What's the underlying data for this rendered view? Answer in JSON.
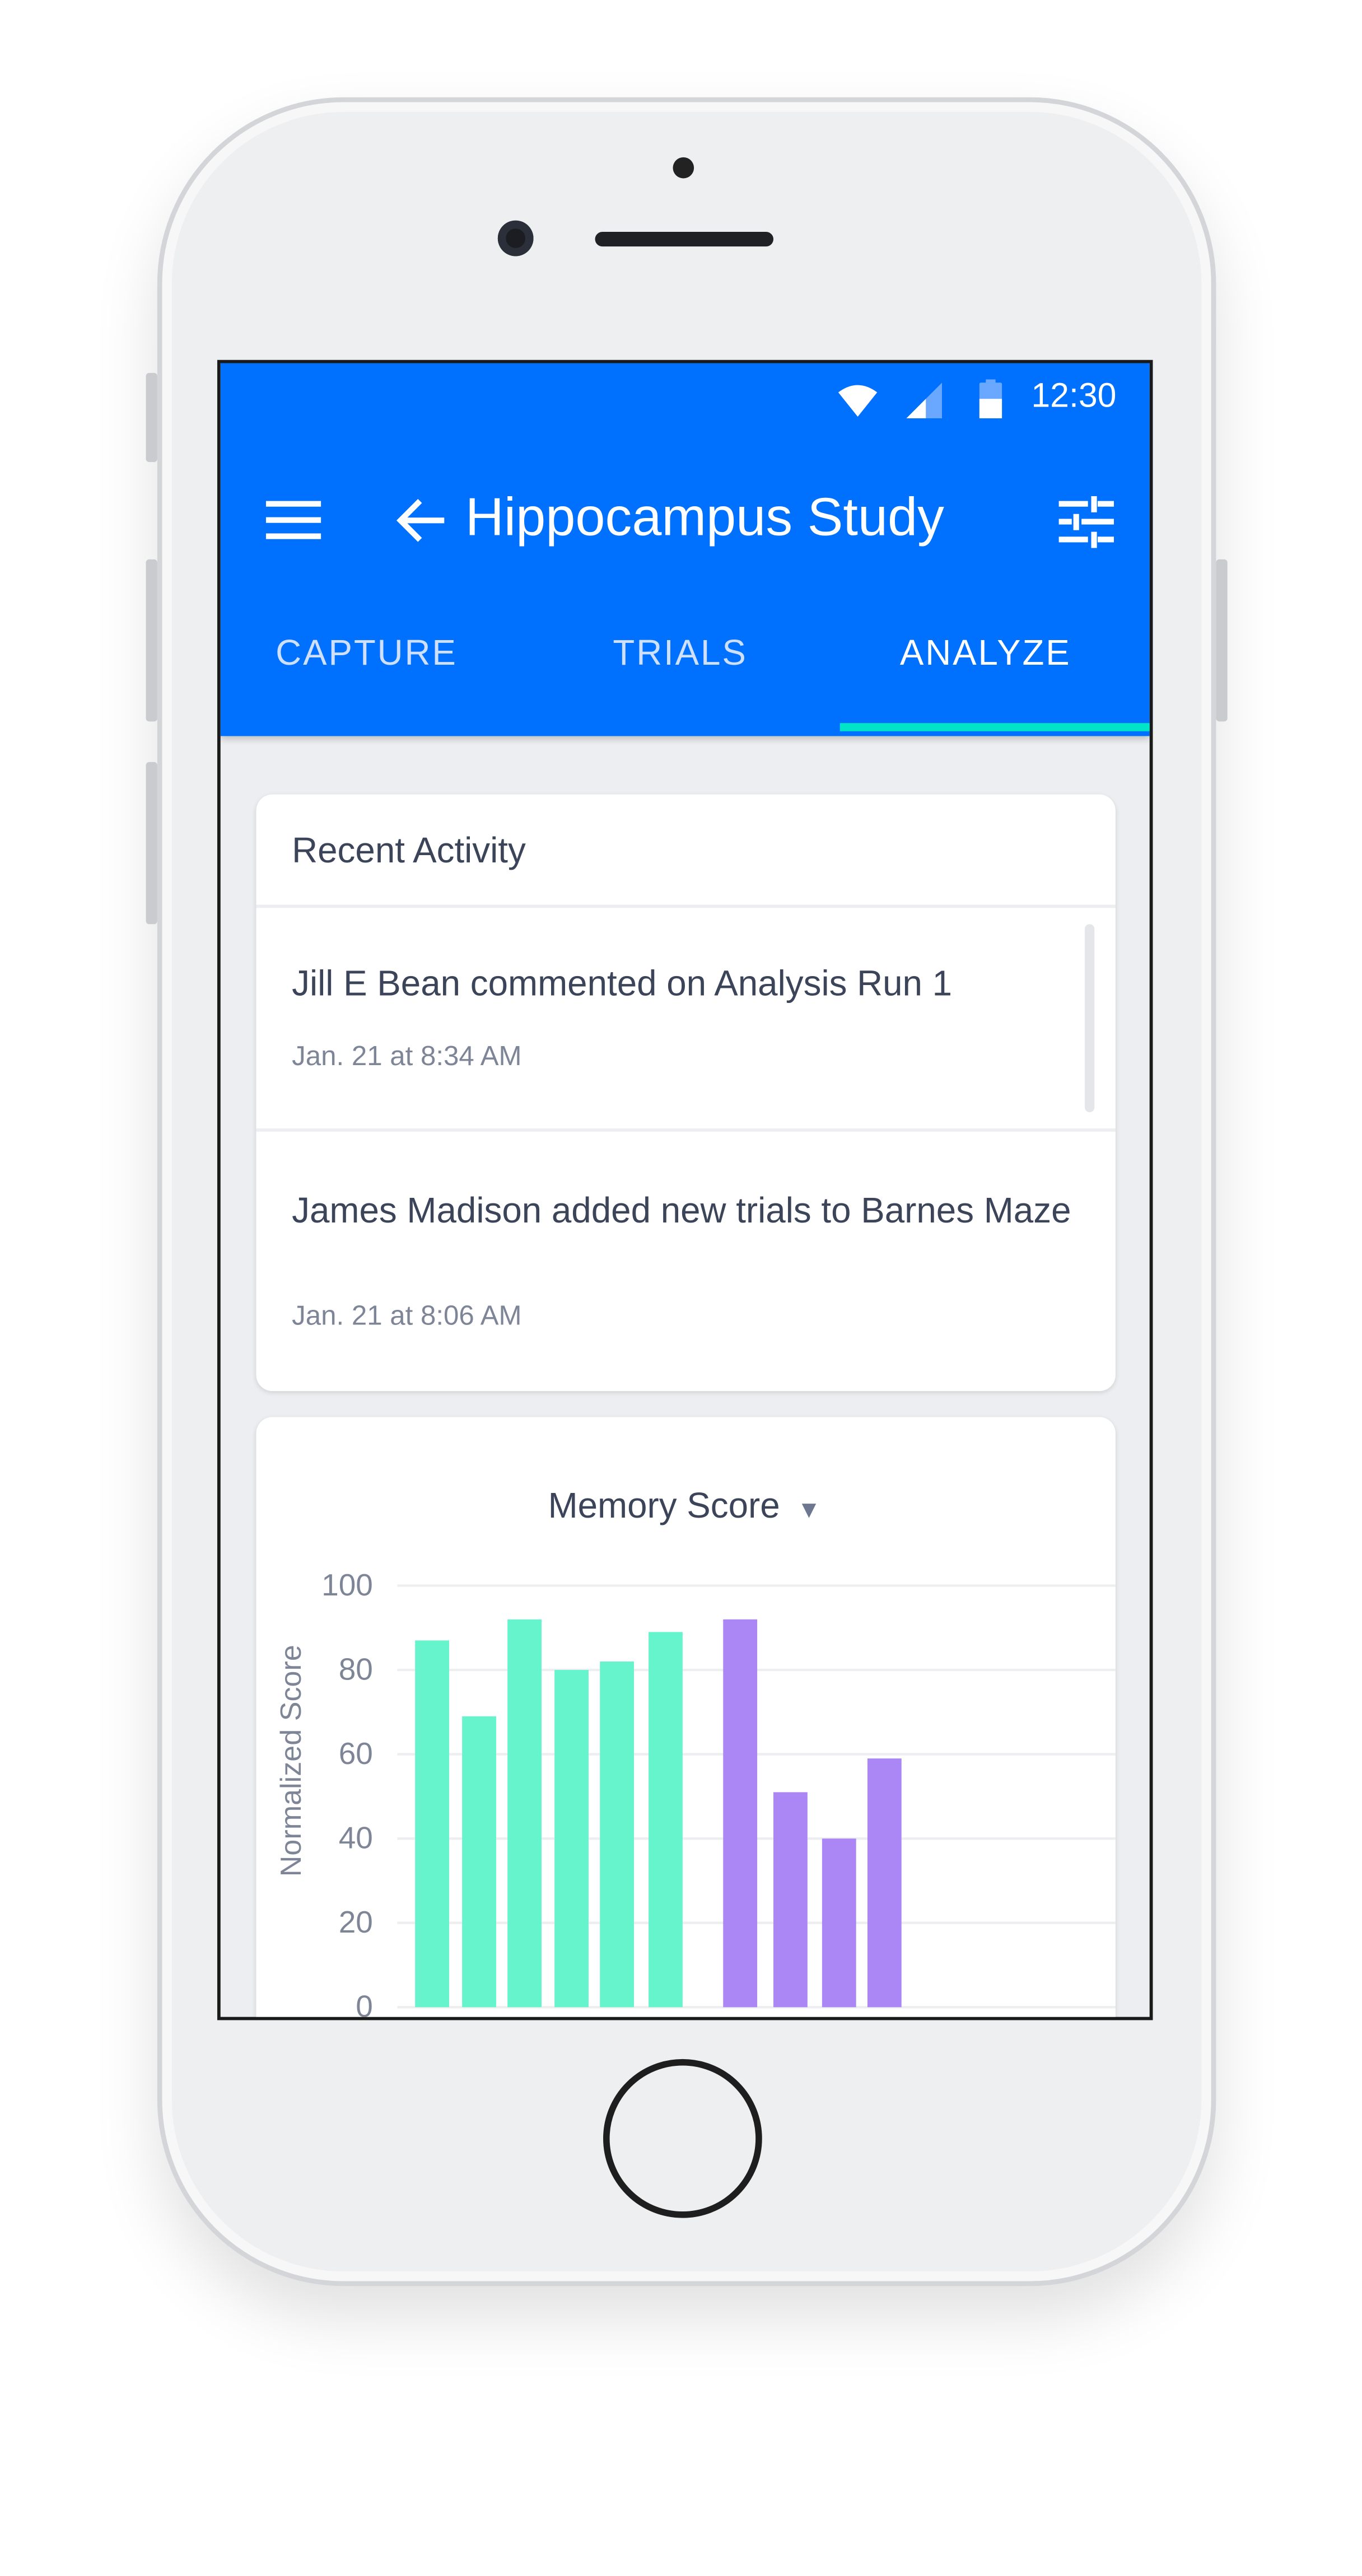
{
  "status_bar": {
    "time": "12:30",
    "icons": [
      "wifi-icon",
      "signal-icon",
      "battery-icon"
    ]
  },
  "toolbar": {
    "title": "Hippocampus Study",
    "icons": [
      "menu-icon",
      "back-arrow-icon",
      "filter-sliders-icon"
    ]
  },
  "tabs": [
    {
      "label": "CAPTURE",
      "active": false
    },
    {
      "label": "TRIALS",
      "active": false
    },
    {
      "label": "ANALYZE",
      "active": true
    }
  ],
  "recent_activity": {
    "title": "Recent Activity",
    "items": [
      {
        "text": "Jill E Bean commented on Analysis Run 1",
        "time": "Jan. 21 at 8:34 AM"
      },
      {
        "text": "James Madison added new trials to Barnes Maze",
        "time": "Jan. 21 at 8:06 AM"
      }
    ]
  },
  "chart_card": {
    "dropdown_label": "Memory Score"
  },
  "colors": {
    "brand": "#0070ff",
    "tab_indicator": "#00e5c8",
    "series_1": "#66f4cc",
    "series_2": "#ab86f5"
  },
  "chart_data": {
    "type": "bar",
    "title": "Memory Score",
    "ylabel": "Normalized Score",
    "ylim": [
      0,
      100
    ],
    "yticks": [
      "100",
      "80",
      "60",
      "40",
      "20",
      "0"
    ],
    "grid": true,
    "series": [
      {
        "values": [
          87,
          69,
          92,
          80,
          82,
          89
        ],
        "color": "#66f4cc"
      },
      {
        "values": [
          92,
          51,
          40,
          59
        ],
        "color": "#ab86f5"
      }
    ]
  }
}
